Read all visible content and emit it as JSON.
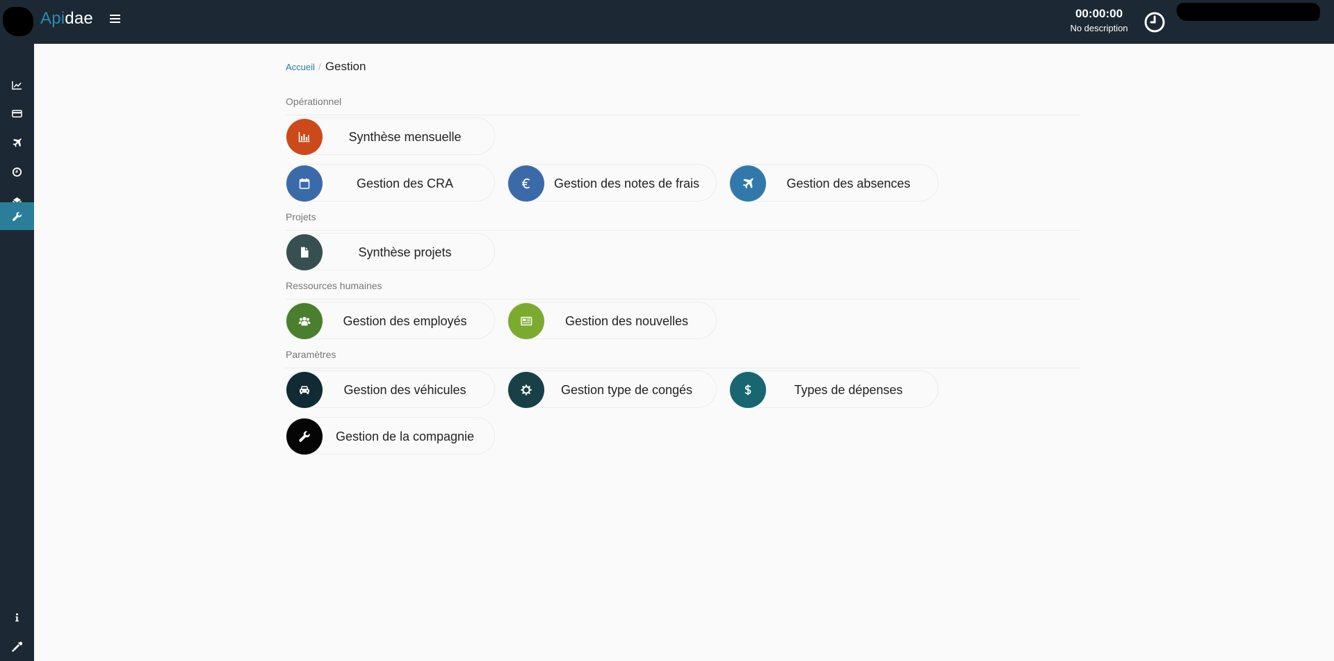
{
  "header": {
    "brand_part1": "Api",
    "brand_part2": "dae",
    "timer": "00:00:00",
    "timer_description": "No description"
  },
  "breadcrumb": {
    "home": "Accueil",
    "separator": "/",
    "current": "Gestion"
  },
  "sections": {
    "operationnel": "Opérationnel",
    "projets": "Projets",
    "rh": "Ressources humaines",
    "parametres": "Paramètres"
  },
  "cards": {
    "synthese_mensuelle": {
      "label": "Synthèse mensuelle",
      "color": "#cc4a1a",
      "icon": "bar-chart-icon"
    },
    "gestion_cra": {
      "label": "Gestion des CRA",
      "color": "#3a6aa8",
      "icon": "calendar-icon"
    },
    "notes_frais": {
      "label": "Gestion des notes de frais",
      "color": "#3a6aa8",
      "icon": "euro-icon"
    },
    "absences": {
      "label": "Gestion des absences",
      "color": "#3279ab",
      "icon": "plane-icon"
    },
    "synthese_projets": {
      "label": "Synthèse projets",
      "color": "#36504f",
      "icon": "file-icon"
    },
    "employes": {
      "label": "Gestion des employés",
      "color": "#4a7f2d",
      "icon": "users-icon"
    },
    "nouvelles": {
      "label": "Gestion des nouvelles",
      "color": "#7bab2e",
      "icon": "newspaper-icon"
    },
    "vehicules": {
      "label": "Gestion des véhicules",
      "color": "#102b33",
      "icon": "car-icon"
    },
    "type_conges": {
      "label": "Gestion type de congés",
      "color": "#174147",
      "icon": "gear-icon"
    },
    "types_depenses": {
      "label": "Types de dépenses",
      "color": "#176670",
      "icon": "dollar-icon"
    },
    "compagnie": {
      "label": "Gestion de la compagnie",
      "color": "#050505",
      "icon": "wrench-icon"
    }
  },
  "sidebar": {
    "items": [
      {
        "icon": "line-chart-icon"
      },
      {
        "icon": "credit-card-icon"
      },
      {
        "icon": "plane-icon"
      },
      {
        "icon": "clock-icon"
      },
      {
        "icon": "envelope-open-icon"
      },
      {
        "icon": "wrench-icon",
        "active": true
      },
      {
        "icon": "info-icon"
      },
      {
        "icon": "eyedropper-icon"
      }
    ]
  },
  "colors": {
    "topbar": "#1c2833",
    "sidebar_active": "#2a7e9a",
    "link": "#2b7aa0",
    "background": "#fafafa"
  }
}
